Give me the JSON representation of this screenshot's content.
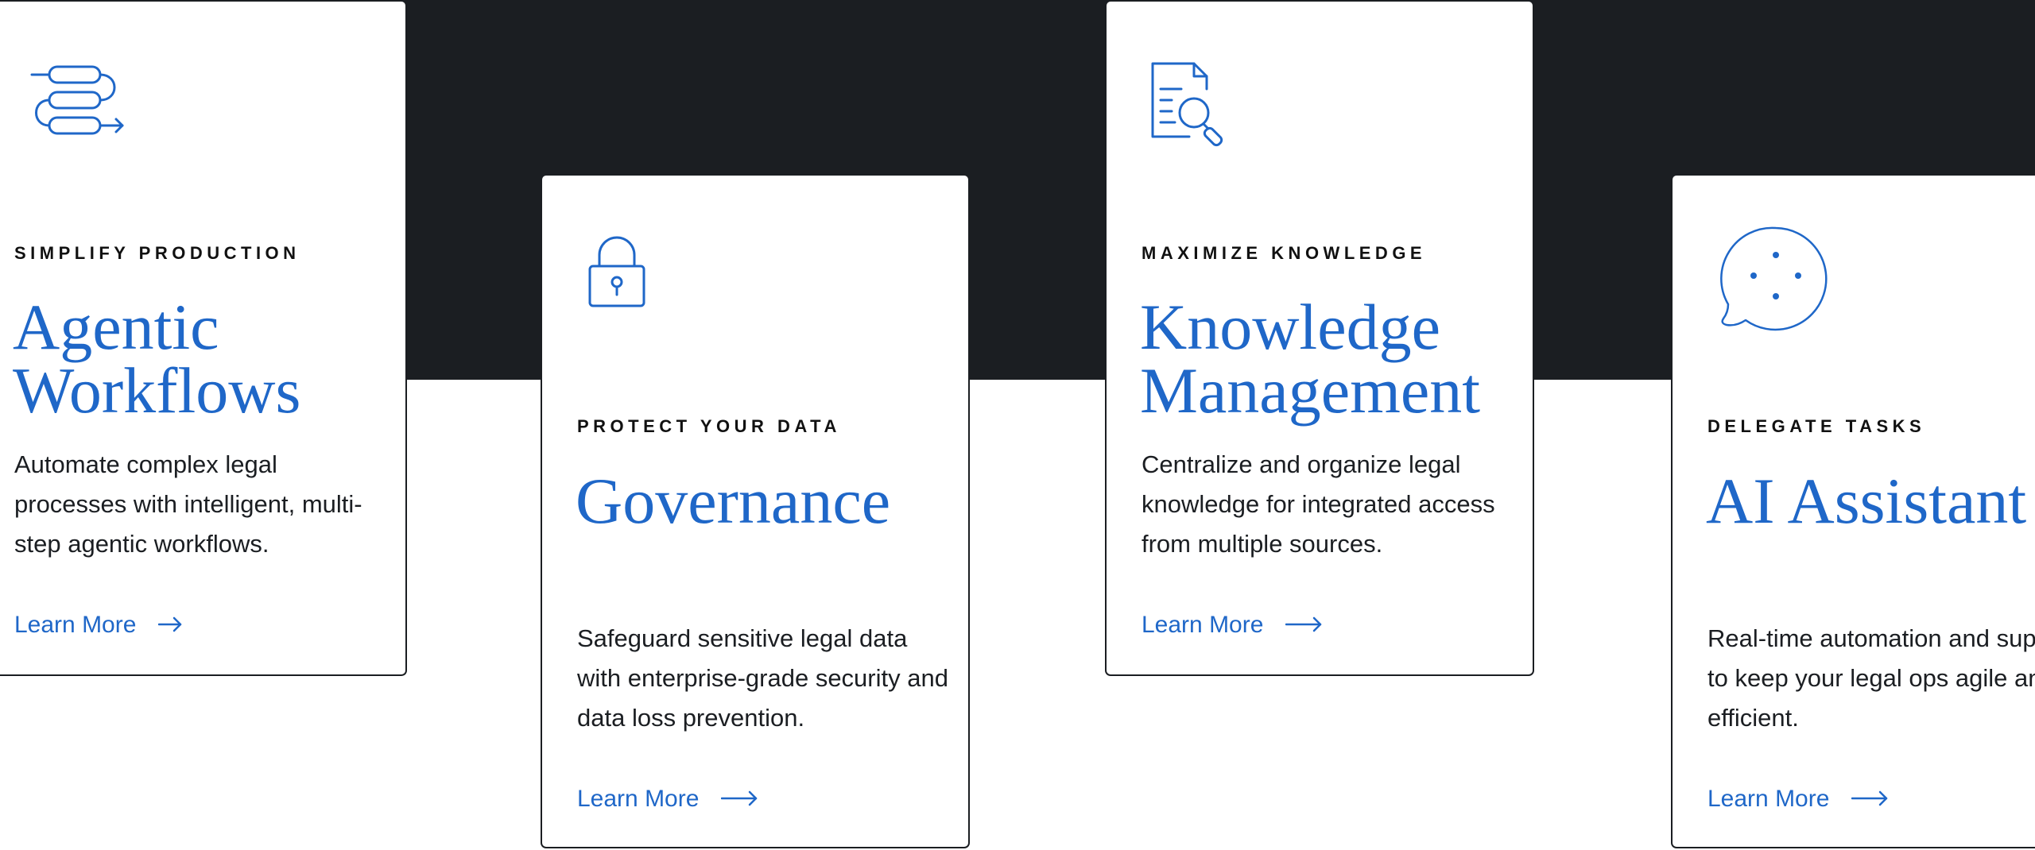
{
  "colors": {
    "dark_band": "#1b1e22",
    "accent": "#1f67c8",
    "text": "#1b1e22"
  },
  "cards": [
    {
      "eyebrow": "SIMPLIFY PRODUCTION",
      "title_line1": "Agentic",
      "title_line2": "Workflows",
      "description": "Automate complex legal processes with intelligent, multi-step agentic workflows.",
      "link_label": "Learn More",
      "icon": "workflow-icon"
    },
    {
      "eyebrow": "PROTECT YOUR DATA",
      "title_line1": "Governance",
      "title_line2": "",
      "description": "Safeguard sensitive legal data with enterprise-grade security and data loss prevention.",
      "link_label": "Learn More",
      "icon": "lock-icon"
    },
    {
      "eyebrow": "MAXIMIZE KNOWLEDGE",
      "title_line1": "Knowledge",
      "title_line2": "Management",
      "description": "Centralize and organize legal knowledge for integrated access from multiple sources.",
      "link_label": "Learn More",
      "icon": "document-search-icon"
    },
    {
      "eyebrow": "DELEGATE TASKS",
      "title_line1": "AI Assistant",
      "title_line2": "",
      "description": "Real-time automation and support to keep your legal ops agile and efficient.",
      "link_label": "Learn More",
      "icon": "chat-bubble-icon"
    }
  ]
}
